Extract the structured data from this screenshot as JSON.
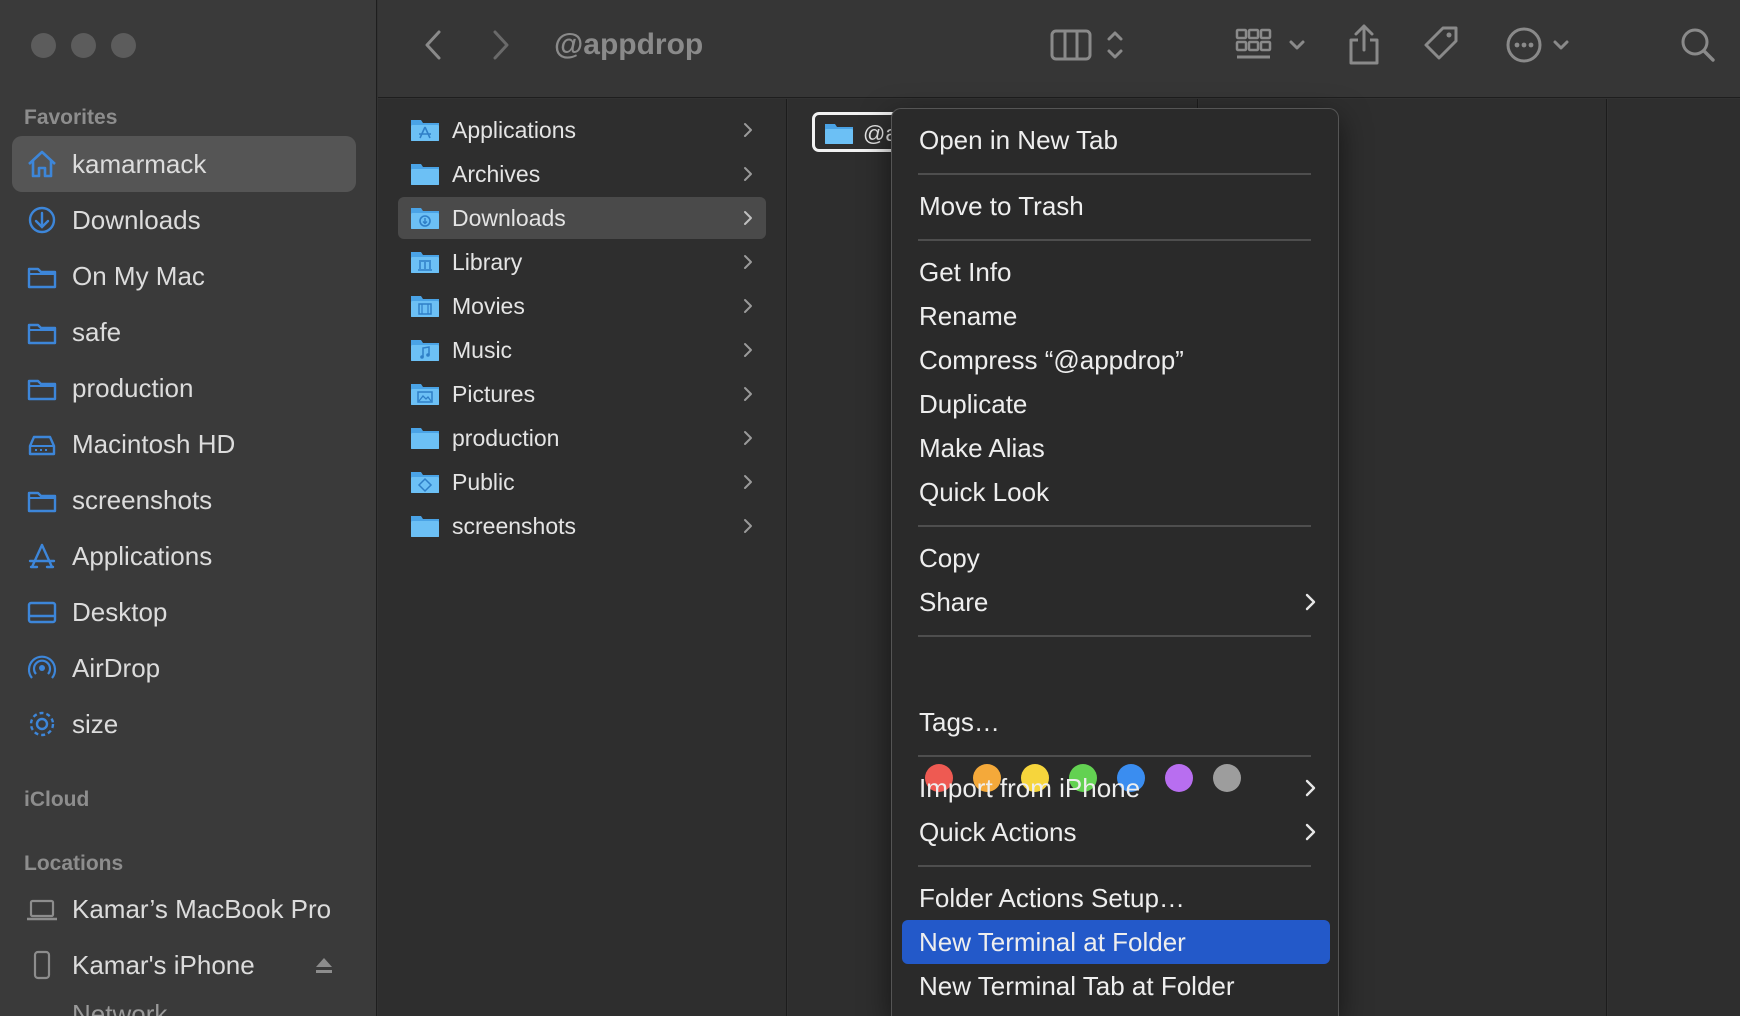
{
  "window": {
    "title": "@appdrop"
  },
  "colors": {
    "accent": "#2359c9",
    "folder": "#5ab4ee",
    "sidebar_icon": "#3d86d9"
  },
  "sidebar": {
    "sections": [
      {
        "title": "Favorites"
      },
      {
        "title": "iCloud"
      },
      {
        "title": "Locations"
      }
    ],
    "favorites": [
      {
        "label": "kamarmack",
        "icon": "house-icon",
        "selected": true
      },
      {
        "label": "Downloads",
        "icon": "download-icon"
      },
      {
        "label": "On My Mac",
        "icon": "folder-icon"
      },
      {
        "label": "safe",
        "icon": "folder-icon"
      },
      {
        "label": "production",
        "icon": "folder-icon"
      },
      {
        "label": "Macintosh HD",
        "icon": "drive-icon"
      },
      {
        "label": "screenshots",
        "icon": "folder-icon"
      },
      {
        "label": "Applications",
        "icon": "applications-icon"
      },
      {
        "label": "Desktop",
        "icon": "desktop-icon"
      },
      {
        "label": "AirDrop",
        "icon": "airdrop-icon"
      },
      {
        "label": "size",
        "icon": "gear-icon"
      }
    ],
    "locations": [
      {
        "label": "Kamar’s MacBook Pro",
        "icon": "laptop-icon"
      },
      {
        "label": "Kamar's iPhone",
        "icon": "phone-icon"
      }
    ]
  },
  "columns": {
    "home_items": [
      {
        "label": "Applications",
        "icon": "applications-folder-icon"
      },
      {
        "label": "Archives",
        "icon": "folder-icon"
      },
      {
        "label": "Downloads",
        "icon": "downloads-folder-icon",
        "selected": true
      },
      {
        "label": "Library",
        "icon": "library-folder-icon"
      },
      {
        "label": "Movies",
        "icon": "movies-folder-icon"
      },
      {
        "label": "Music",
        "icon": "music-folder-icon"
      },
      {
        "label": "Pictures",
        "icon": "pictures-folder-icon"
      },
      {
        "label": "production",
        "icon": "folder-icon"
      },
      {
        "label": "Public",
        "icon": "public-folder-icon"
      },
      {
        "label": "screenshots",
        "icon": "folder-icon"
      }
    ],
    "downloads_item": {
      "label": "@appdrop"
    }
  },
  "context_menu": {
    "groups": [
      [
        {
          "label": "Open in New Tab"
        }
      ],
      [
        {
          "label": "Move to Trash"
        }
      ],
      [
        {
          "label": "Get Info"
        },
        {
          "label": "Rename"
        },
        {
          "label": "Compress “@appdrop”"
        },
        {
          "label": "Duplicate"
        },
        {
          "label": "Make Alias"
        },
        {
          "label": "Quick Look"
        }
      ],
      [
        {
          "label": "Copy"
        },
        {
          "label": "Share",
          "submenu": true
        }
      ],
      [
        {
          "label": "Tags…"
        }
      ],
      [
        {
          "label": "Import from iPhone",
          "submenu": true
        },
        {
          "label": "Quick Actions",
          "submenu": true
        }
      ],
      [
        {
          "label": "Folder Actions Setup…"
        },
        {
          "label": "New Terminal at Folder",
          "highlighted": true
        },
        {
          "label": "New Terminal Tab at Folder"
        }
      ]
    ],
    "tag_colors": [
      {
        "name": "red",
        "hex": "#ee5a52"
      },
      {
        "name": "orange",
        "hex": "#f4a93a"
      },
      {
        "name": "yellow",
        "hex": "#f6d53c"
      },
      {
        "name": "green",
        "hex": "#63d152"
      },
      {
        "name": "blue",
        "hex": "#3a8df0"
      },
      {
        "name": "purple",
        "hex": "#b86ef0"
      },
      {
        "name": "gray",
        "hex": "#9d9d9d"
      }
    ]
  }
}
